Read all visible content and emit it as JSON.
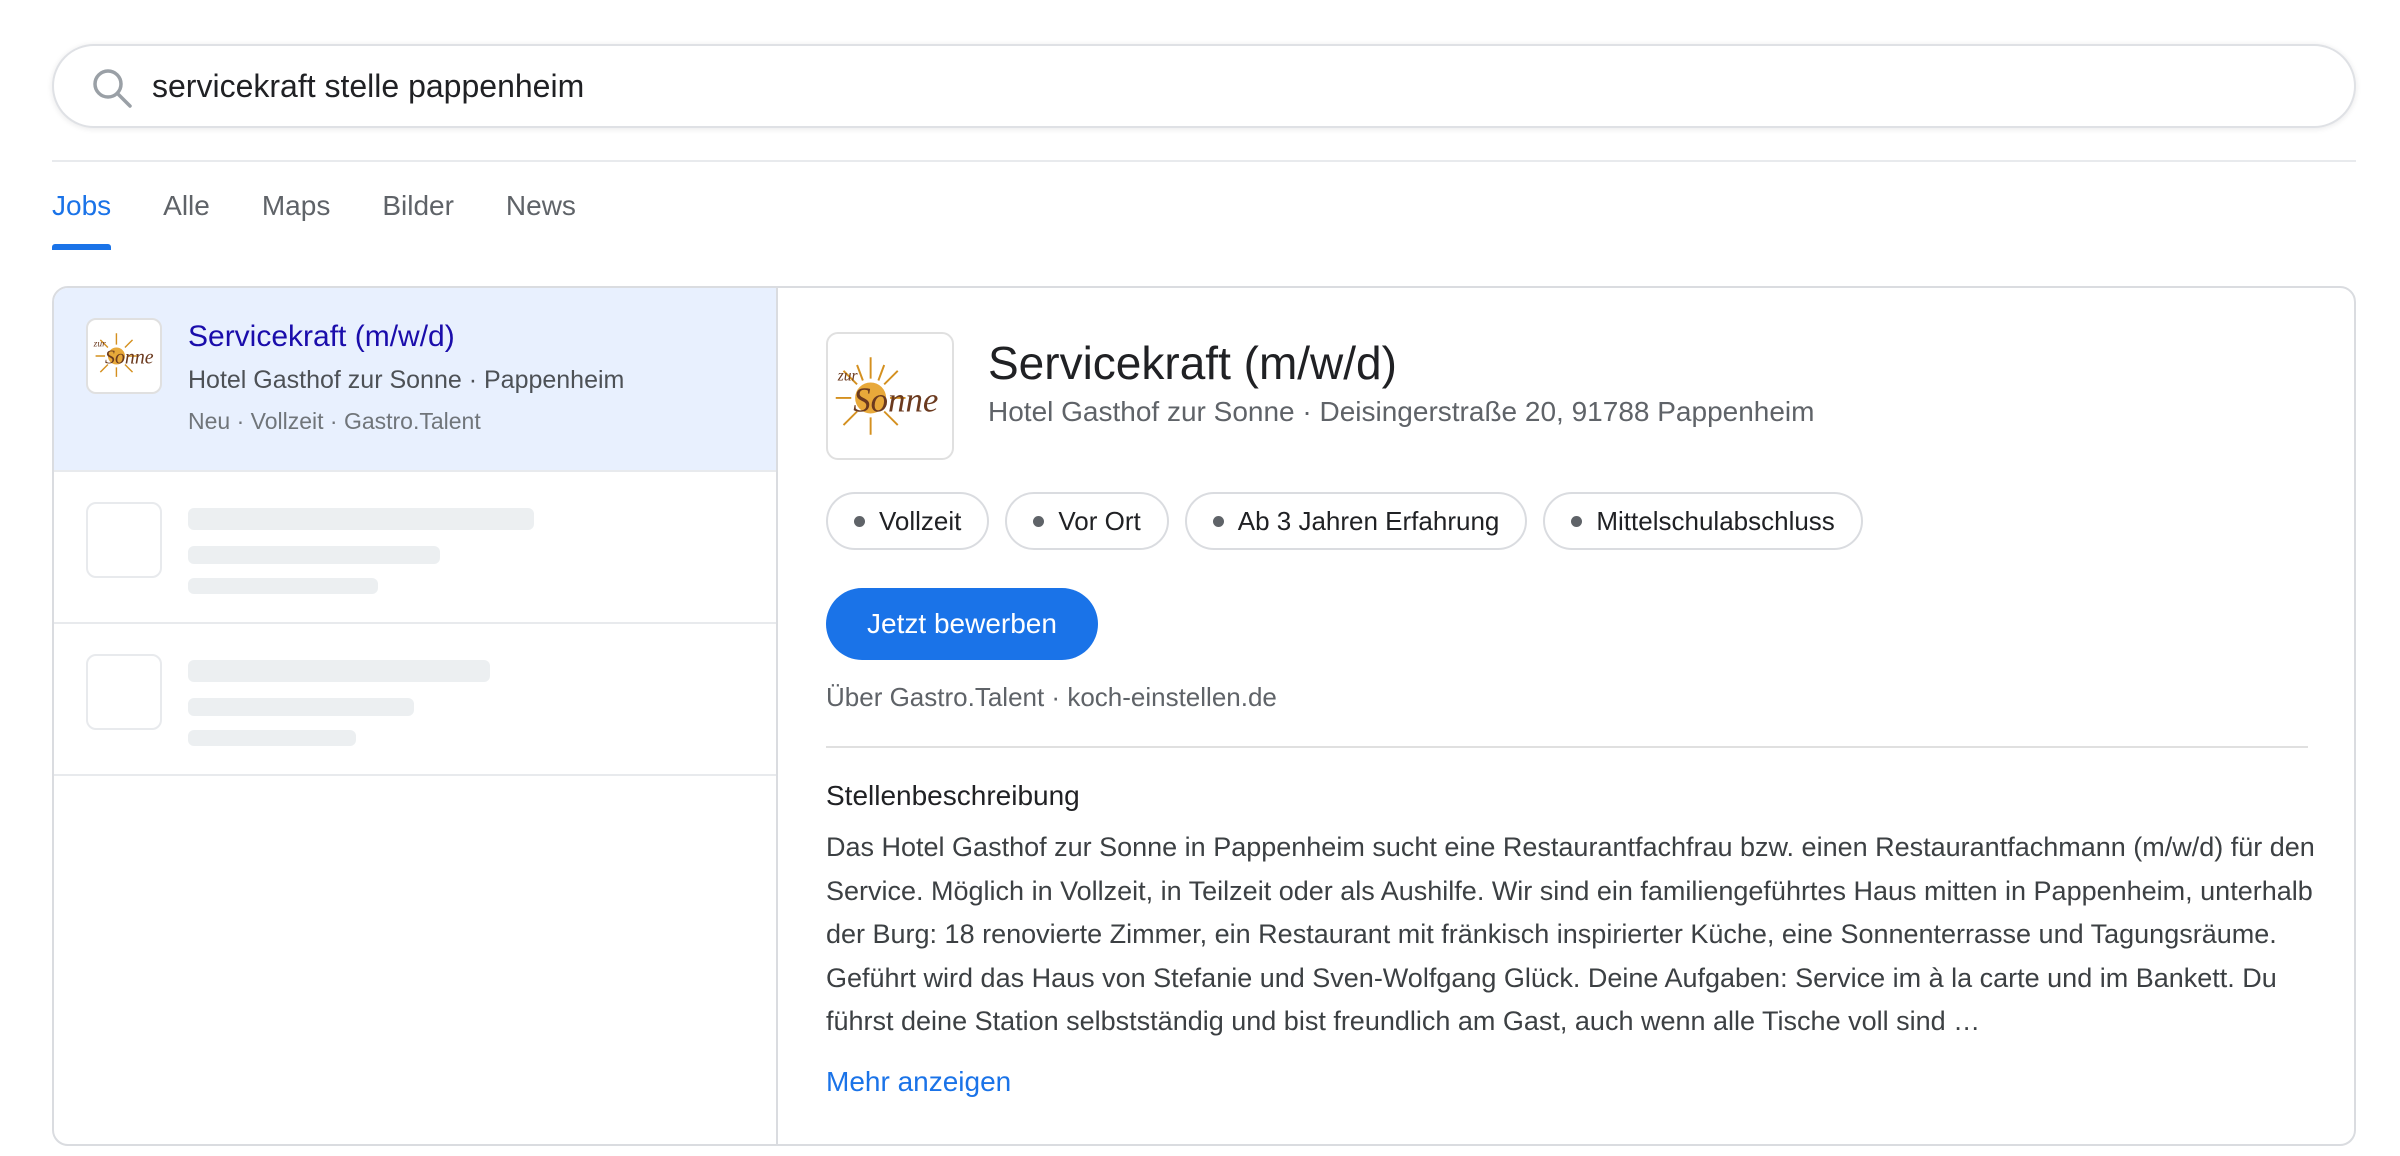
{
  "search": {
    "query": "servicekraft stelle pappenheim"
  },
  "tabs": [
    {
      "label": "Jobs",
      "active": true
    },
    {
      "label": "Alle",
      "active": false
    },
    {
      "label": "Maps",
      "active": false
    },
    {
      "label": "Bilder",
      "active": false
    },
    {
      "label": "News",
      "active": false
    }
  ],
  "job_list": {
    "selected": {
      "title": "Servicekraft (m/w/d)",
      "company": "Hotel Gasthof zur Sonne · Pappenheim",
      "meta": "Neu · Vollzeit · Gastro.Talent",
      "logo_text_top": "zur",
      "logo_text_main": "Sonne"
    }
  },
  "detail": {
    "title": "Servicekraft (m/w/d)",
    "company": "Hotel Gasthof zur Sonne · Deisingerstraße 20, 91788 Pappenheim",
    "chips": [
      "Vollzeit",
      "Vor Ort",
      "Ab 3 Jahren Erfahrung",
      "Mittelschulabschluss"
    ],
    "apply_label": "Jetzt bewerben",
    "via": "Über Gastro.Talent · koch-einstellen.de",
    "description_heading": "Stellenbeschreibung",
    "description": "Das Hotel Gasthof zur Sonne in Pappenheim sucht eine Restaurantfachfrau bzw. einen Restaurantfachmann (m/w/d) für den Service. Möglich in Vollzeit, in Teilzeit oder als Aushilfe. Wir sind ein familiengeführtes Haus mitten in Pappenheim, unterhalb der Burg: 18 renovierte Zimmer, ein Restaurant mit fränkisch inspirierter Küche, eine Sonnenterrasse und Tagungsräume. Geführt wird das Haus von Stefanie und Sven-Wolfgang Glück. Deine Aufgaben: Service im à la carte und im Bankett. Du führst deine Station selbstständig und bist freundlich am Gast, auch wenn alle Tische voll sind …",
    "more_label": "Mehr anzeigen"
  },
  "colors": {
    "accent": "#1a73e8",
    "link_title": "#1a0dab",
    "selected_bg": "#e8f0fe",
    "logo_gold": "#d4901f",
    "logo_brown": "#6b3a1f"
  },
  "icons": {
    "search": "search-icon",
    "logo": "sun-logo-icon"
  }
}
